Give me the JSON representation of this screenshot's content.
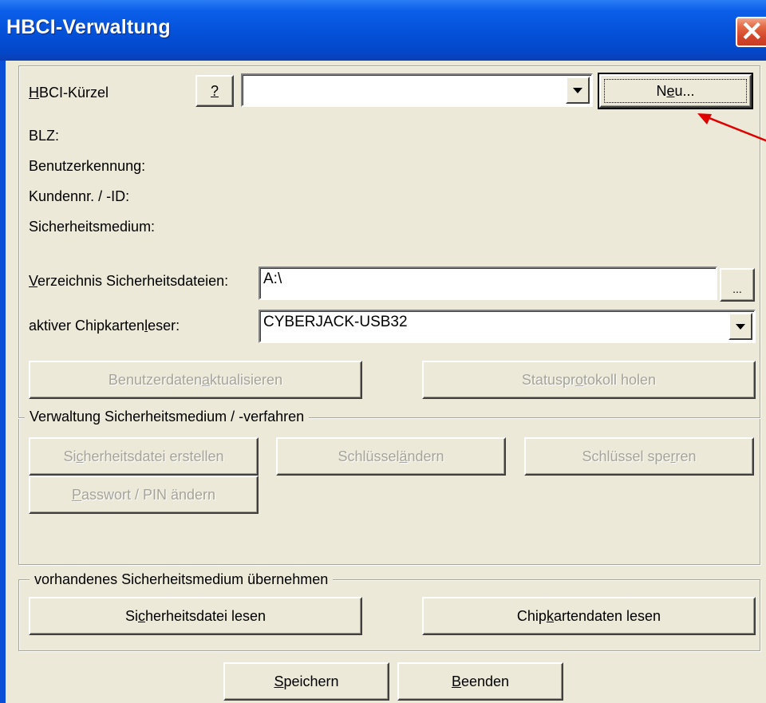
{
  "window": {
    "title": "HBCI-Verwaltung",
    "close_glyph": "✕"
  },
  "account": {
    "kuerzel_label_mnemonic": "H",
    "kuerzel_label_rest": "BCI-Kürzel",
    "help_button_label": "?",
    "kuerzel_value": "",
    "new_button_prefix": "N",
    "new_button_mnemonic": "e",
    "new_button_suffix": "u...",
    "blz_label": "BLZ:",
    "benutzerkennung_label": "Benutzerkennung:",
    "kundennr_label": "Kundennr. / -ID:",
    "sicherheitsmedium_label": "Sicherheitsmedium:"
  },
  "settings": {
    "dir_label_mnemonic": "V",
    "dir_label_rest": "erzeichnis Sicherheitsdateien:",
    "dir_value": "A:\\",
    "browse_label": "...",
    "reader_label_prefix": "aktiver Chipkarten",
    "reader_label_mnemonic": "l",
    "reader_label_suffix": "eser:",
    "reader_value": "CYBERJACK-USB32"
  },
  "actions": {
    "update_prefix": "Benutzerdaten ",
    "update_mnemonic": "a",
    "update_suffix": "ktualisieren",
    "status_prefix": "Statuspr",
    "status_mnemonic": "o",
    "status_suffix": "tokoll holen"
  },
  "security_group": {
    "legend": "Verwaltung Sicherheitsmedium / -verfahren",
    "create_prefix": "Si",
    "create_mnemonic": "c",
    "create_suffix": "herheitsdatei erstellen",
    "change_key_prefix": "Schlüssel ",
    "change_key_mnemonic": "ä",
    "change_key_suffix": "ndern",
    "lock_key_prefix": "Schlüssel spe",
    "lock_key_mnemonic": "r",
    "lock_key_suffix": "ren",
    "pin_mnemonic": "P",
    "pin_suffix": "asswort / PIN ändern"
  },
  "import_group": {
    "legend": "vorhandenes Sicherheitsmedium übernehmen",
    "read_file_prefix": "Si",
    "read_file_mnemonic": "c",
    "read_file_suffix": "herheitsdatei lesen",
    "read_card_prefix": "Chip",
    "read_card_mnemonic": "k",
    "read_card_suffix": "artendaten lesen"
  },
  "footer": {
    "save_mnemonic": "S",
    "save_suffix": "peichern",
    "exit_mnemonic": "B",
    "exit_suffix": "eenden"
  },
  "annotation": {
    "arrow_color": "#e00000"
  }
}
